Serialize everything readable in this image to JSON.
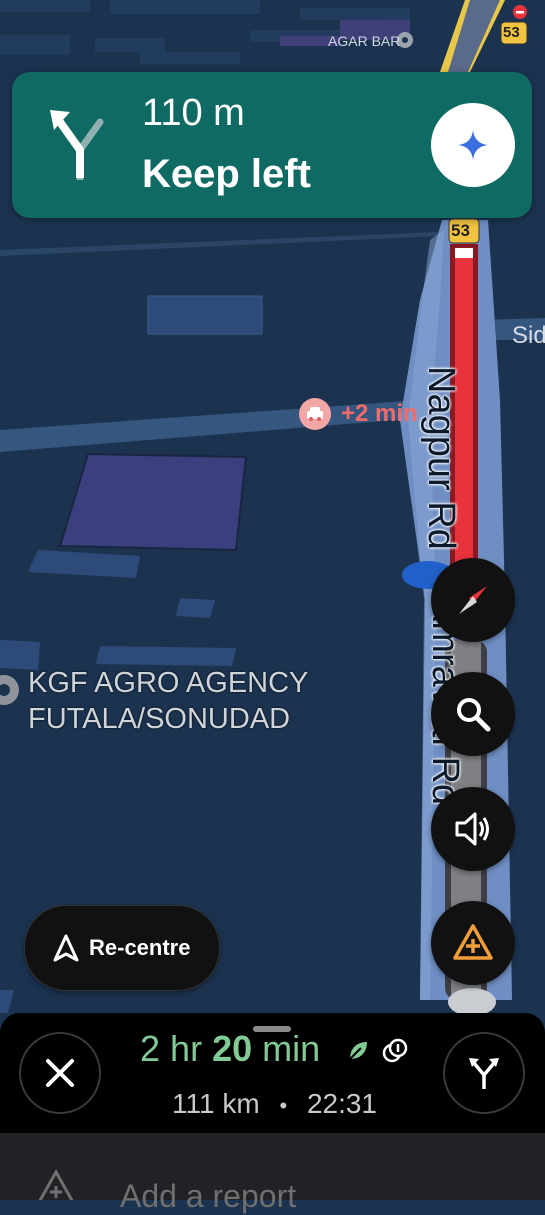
{
  "map": {
    "place_top": "AGAR BAR",
    "road_name": "Nagpur Rd",
    "road_name_lower": "Amravati Rd",
    "side_label": "Sid",
    "shield_top": "53",
    "shield_mid": "53",
    "poi": {
      "line1": "KGF AGRO AGENCY",
      "line2": "FUTALA/SONUDAD"
    },
    "delay": "+2 min"
  },
  "nav": {
    "distance": "110 m",
    "instruction": "Keep left"
  },
  "controls": {
    "recentre_label": "Re-centre"
  },
  "trip": {
    "eta_hr": "2",
    "eta_hr_unit": "hr",
    "eta_min": "20",
    "eta_min_unit": "min",
    "distance": "111 km",
    "separator": "•",
    "arrival": "22:31"
  },
  "report": {
    "label": "Add a report"
  },
  "colors": {
    "banner": "#0f6a64",
    "eta": "#81c995",
    "delay": "#f06b6b",
    "route_traffic": "#e8323c"
  }
}
